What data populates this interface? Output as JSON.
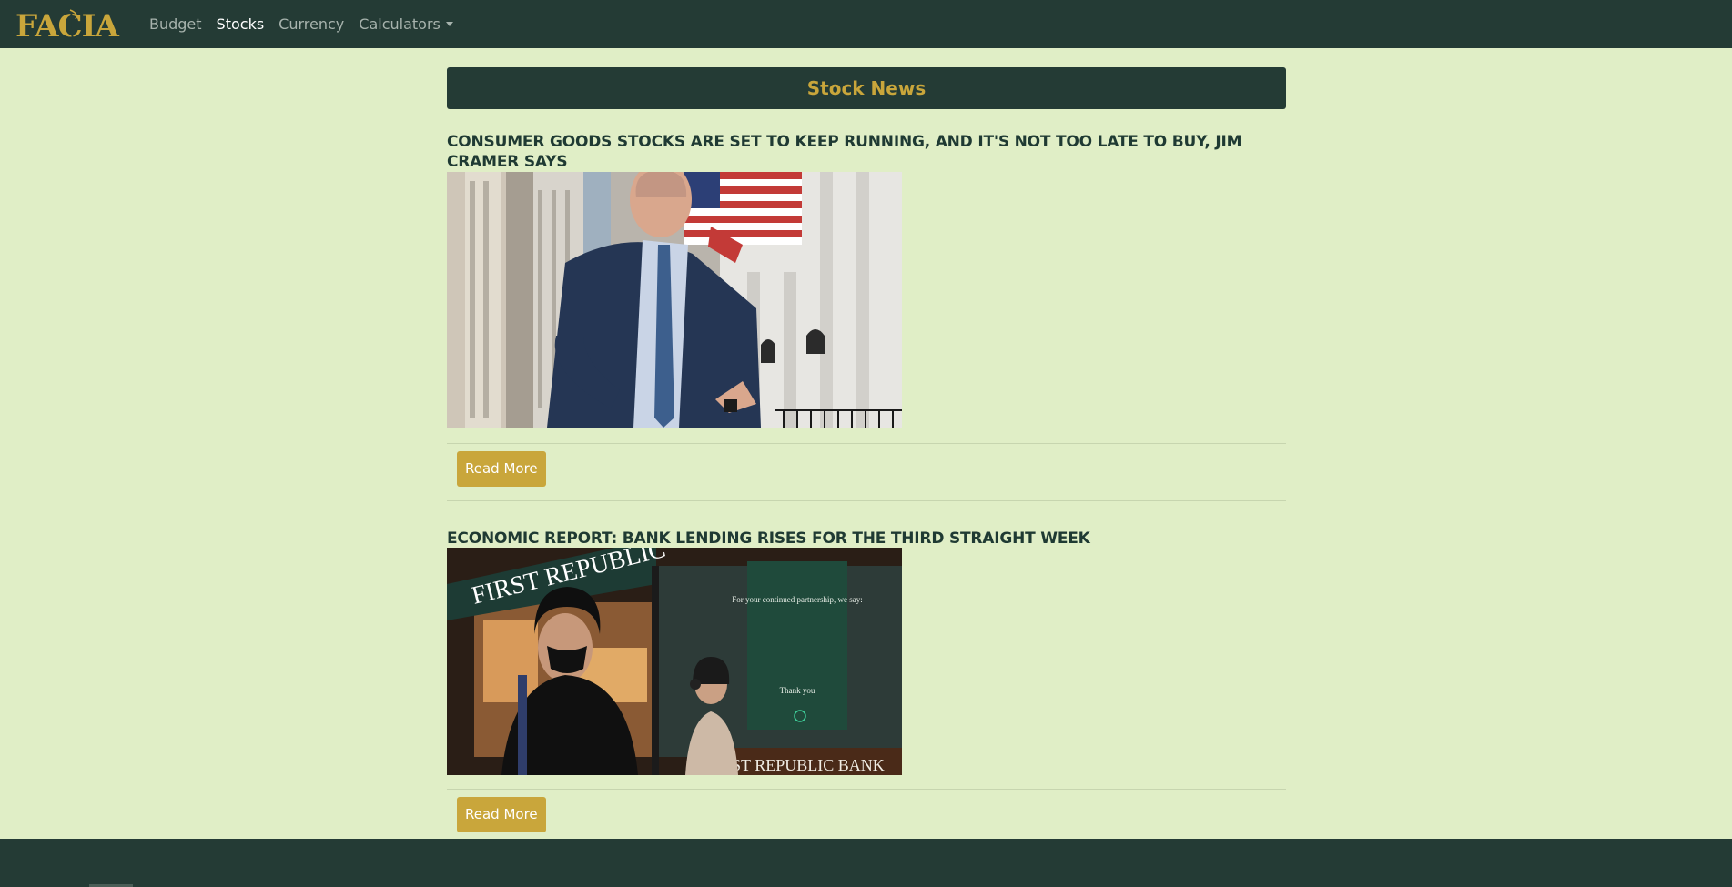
{
  "nav": {
    "logo_text": "FACIA",
    "links": [
      {
        "label": "Budget",
        "active": false
      },
      {
        "label": "Stocks",
        "active": true
      },
      {
        "label": "Currency",
        "active": false
      },
      {
        "label": "Calculators",
        "active": false,
        "dropdown": true
      }
    ]
  },
  "page": {
    "heading": "Stock News"
  },
  "articles": [
    {
      "title": "CONSUMER GOODS STOCKS ARE SET TO KEEP RUNNING, AND IT'S NOT TOO LATE TO BUY, JIM CRAMER SAYS",
      "button_label": "Read More"
    },
    {
      "title": "ECONOMIC REPORT: BANK LENDING RISES FOR THE THIRD STRAIGHT WEEK",
      "button_label": "Read More",
      "image_texts": [
        "FIRST REPUBLIC",
        "For your continued partnership, we say:",
        "Thank you",
        "FIRST REPUBLIC BANK"
      ]
    }
  ],
  "colors": {
    "navbar": "#243b35",
    "page_background": "#e0eec6",
    "accent_gold": "#c9a63b",
    "title_text": "#1f3a33"
  }
}
